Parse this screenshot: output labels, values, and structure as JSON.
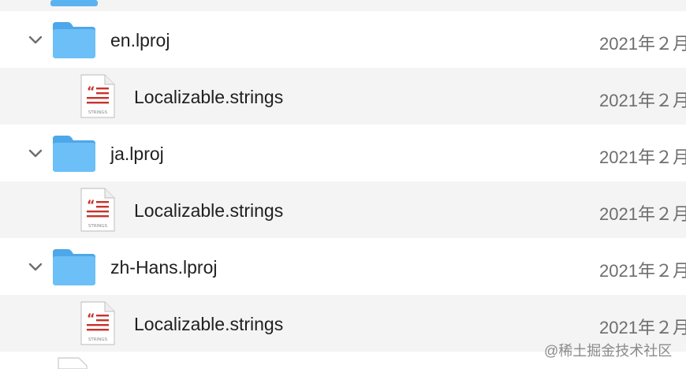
{
  "rows": [
    {
      "type": "folder",
      "name": "en.lproj",
      "date": "2021年２月"
    },
    {
      "type": "file",
      "name": "Localizable.strings",
      "icon_label": "STRINGS",
      "date": "2021年２月"
    },
    {
      "type": "folder",
      "name": "ja.lproj",
      "date": "2021年２月"
    },
    {
      "type": "file",
      "name": "Localizable.strings",
      "icon_label": "STRINGS",
      "date": "2021年２月"
    },
    {
      "type": "folder",
      "name": "zh-Hans.lproj",
      "date": "2021年２月"
    },
    {
      "type": "file",
      "name": "Localizable.strings",
      "icon_label": "STRINGS",
      "date": "2021年２月"
    }
  ],
  "watermark": "@稀土掘金技术社区",
  "colors": {
    "folder_blue": "#5ab3f0",
    "strings_red": "#c8322a",
    "alt_row": "#f4f4f4"
  },
  "icons": {
    "folder": "folder-icon",
    "file": "strings-file-icon",
    "disclosure": "chevron-down-icon"
  }
}
